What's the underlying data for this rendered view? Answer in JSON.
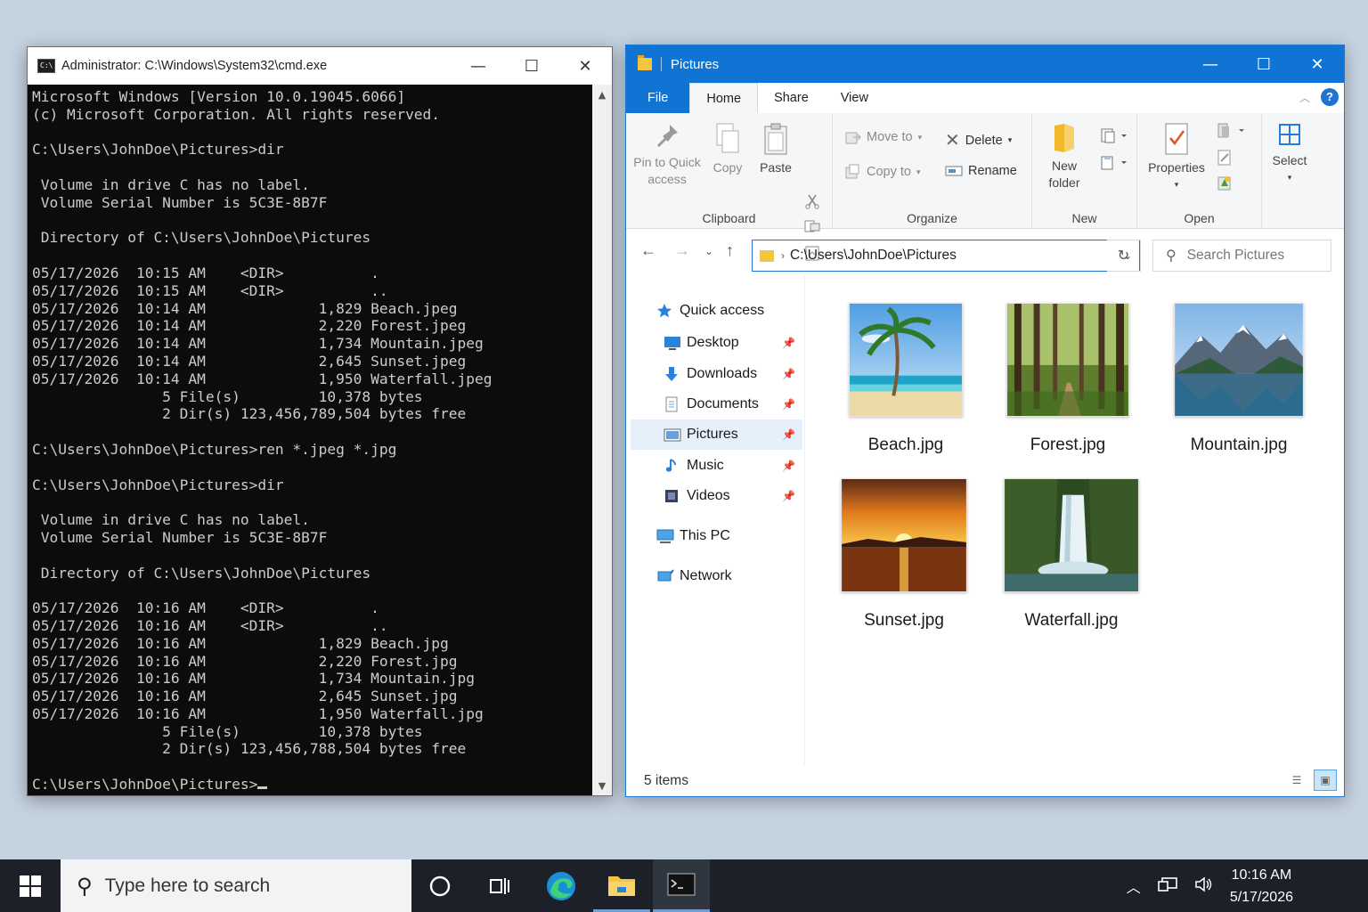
{
  "cmd": {
    "title": "Administrator: C:\\Windows\\System32\\cmd.exe",
    "controls": {
      "minimize": "—",
      "maximize": "☐",
      "close": "✕"
    },
    "lines": [
      "Microsoft Windows [Version 10.0.19045.6066]",
      "(c) Microsoft Corporation. All rights reserved.",
      "",
      "C:\\Users\\JohnDoe\\Pictures>dir",
      "",
      " Volume in drive C has no label.",
      " Volume Serial Number is 5C3E-8B7F",
      "",
      " Directory of C:\\Users\\JohnDoe\\Pictures",
      "",
      "05/17/2026  10:15 AM    <DIR>          .",
      "05/17/2026  10:15 AM    <DIR>          ..",
      "05/17/2026  10:14 AM             1,829 Beach.jpeg",
      "05/17/2026  10:14 AM             2,220 Forest.jpeg",
      "05/17/2026  10:14 AM             1,734 Mountain.jpeg",
      "05/17/2026  10:14 AM             2,645 Sunset.jpeg",
      "05/17/2026  10:14 AM             1,950 Waterfall.jpeg",
      "               5 File(s)         10,378 bytes",
      "               2 Dir(s) 123,456,789,504 bytes free",
      "",
      "C:\\Users\\JohnDoe\\Pictures>ren *.jpeg *.jpg",
      "",
      "C:\\Users\\JohnDoe\\Pictures>dir",
      "",
      " Volume in drive C has no label.",
      " Volume Serial Number is 5C3E-8B7F",
      "",
      " Directory of C:\\Users\\JohnDoe\\Pictures",
      "",
      "05/17/2026  10:16 AM    <DIR>          .",
      "05/17/2026  10:16 AM    <DIR>          ..",
      "05/17/2026  10:16 AM             1,829 Beach.jpg",
      "05/17/2026  10:16 AM             2,220 Forest.jpg",
      "05/17/2026  10:16 AM             1,734 Mountain.jpg",
      "05/17/2026  10:16 AM             2,645 Sunset.jpg",
      "05/17/2026  10:16 AM             1,950 Waterfall.jpg",
      "               5 File(s)         10,378 bytes",
      "               2 Dir(s) 123,456,788,504 bytes free",
      "",
      "C:\\Users\\JohnDoe\\Pictures>"
    ]
  },
  "explorer": {
    "title": "Pictures",
    "controls": {
      "minimize": "—",
      "maximize": "☐",
      "close": "✕"
    },
    "tabs": {
      "file": "File",
      "home": "Home",
      "share": "Share",
      "view": "View"
    },
    "ribbon": {
      "pin_label": "Pin to Quick access",
      "copy_label": "Copy",
      "paste_label": "Paste",
      "clipboard_group": "Clipboard",
      "move_to": "Move to",
      "copy_to": "Copy to",
      "delete": "Delete",
      "rename": "Rename",
      "organize_group": "Organize",
      "new_folder": "New folder",
      "new_group": "New",
      "properties": "Properties",
      "open_group": "Open",
      "select": "Select"
    },
    "address": "C:\\Users\\JohnDoe\\Pictures",
    "search_placeholder": "Search Pictures",
    "nav": {
      "quick_access": "Quick access",
      "desktop": "Desktop",
      "downloads": "Downloads",
      "documents": "Documents",
      "pictures": "Pictures",
      "music": "Music",
      "videos": "Videos",
      "this_pc": "This PC",
      "network": "Network"
    },
    "files": [
      "Beach.jpg",
      "Forest.jpg",
      "Mountain.jpg",
      "Sunset.jpg",
      "Waterfall.jpg"
    ],
    "status": "5 items"
  },
  "taskbar": {
    "search_placeholder": "Type here to search",
    "time": "10:16 AM",
    "date": "5/17/2026"
  },
  "colors": {
    "accent": "#0f74d4",
    "cmd_bg": "#0c0c0c",
    "cmd_text": "#cccccc",
    "taskbar": "#1c2129",
    "desktop": "#c5d2e0"
  }
}
